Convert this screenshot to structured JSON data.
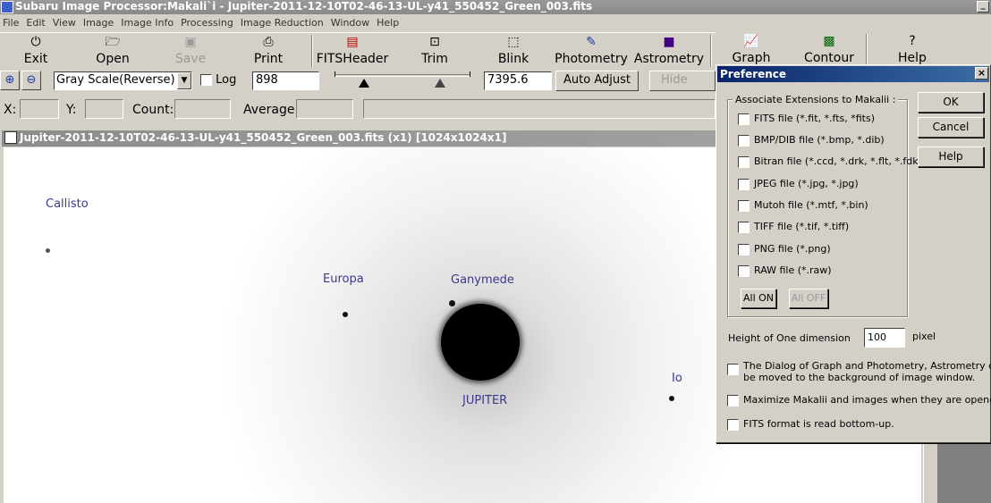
{
  "app": {
    "title": "Subaru Image Processor:Makali`i - Jupiter-2011-12-10T02-46-13-UL-y41_550452_Green_003.fits"
  },
  "menu": [
    "File",
    "Edit",
    "View",
    "Image",
    "Image Info",
    "Processing",
    "Image Reduction",
    "Window",
    "Help"
  ],
  "toolbar": {
    "exit": "Exit",
    "open": "Open",
    "save": "Save",
    "print": "Print",
    "fitsheader": "FITSHeader",
    "trim": "Trim",
    "blink": "Blink",
    "photometry": "Photometry",
    "astrometry": "Astrometry",
    "graph": "Graph",
    "contour": "Contour",
    "help": "Help"
  },
  "display": {
    "scale": "Gray Scale(Reverse)",
    "log_label": "Log",
    "min_value": "898",
    "max_value": "7395.6",
    "auto_adjust": "Auto Adjust",
    "hide_marks": "Hide Marks"
  },
  "status": {
    "x_label": "X:",
    "y_label": "Y:",
    "count_label": "Count:",
    "average_label": "Average"
  },
  "image_window": {
    "title": "Jupiter-2011-12-10T02-46-13-UL-y41_550452_Green_003.fits (x1) [1024x1024x1]"
  },
  "image": {
    "labels": {
      "callisto": "Callisto",
      "europa": "Europa",
      "ganymede": "Ganymede",
      "jupiter": "JUPITER",
      "io": "Io"
    }
  },
  "preference": {
    "title": "Preference",
    "group_title": "Associate Extensions to Makalii :",
    "extensions": [
      "FITS file (*.fit, *.fts, *fits)",
      "BMP/DIB file (*.bmp, *.dib)",
      "Bitran file (*.ccd, *.drk, *.flt, *.fdk)",
      "JPEG file (*.jpg, *.jpg)",
      "Mutoh file (*.mtf, *.bin)",
      "TIFF file (*.tif, *.tiff)",
      "PNG file (*.png)",
      "RAW file (*.raw)"
    ],
    "all_on": "All ON",
    "all_off": "All OFF",
    "ok": "OK",
    "cancel": "Cancel",
    "help": "Help",
    "height_label": "Height of One dimension",
    "height_value": "100",
    "height_unit": "pixel",
    "opt_background_line1": "The Dialog of Graph and Photometry, Astrometry can",
    "opt_background_line2": "be moved to the background of image window.",
    "opt_maximize": "Maximize Makalii and images when they are opend.",
    "opt_bottom_up": "FITS format is read bottom-up."
  }
}
